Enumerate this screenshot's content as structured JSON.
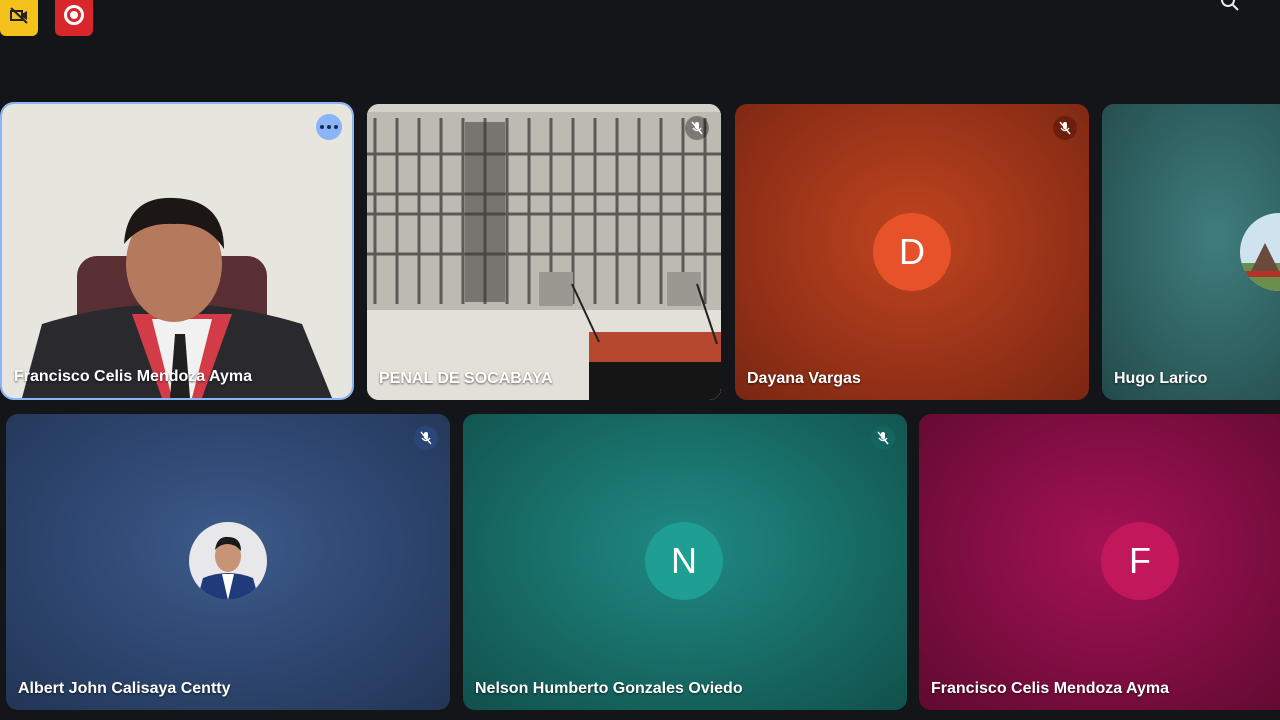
{
  "toolbar": {
    "left_icons": [
      "camera-off-icon",
      "record-icon"
    ],
    "right_icon": "search-icon"
  },
  "tiles": [
    {
      "name": "Francisco Celis Mendoza Ayma",
      "kind": "video",
      "active_speaker": true,
      "has_more_options": true
    },
    {
      "name": "PENAL DE SOCABAYA",
      "kind": "video",
      "muted": true
    },
    {
      "name": "Dayana Vargas",
      "kind": "letter-avatar",
      "initial": "D",
      "avatar_color": "#e8522a",
      "muted": true
    },
    {
      "name": "Hugo Larico",
      "kind": "photo-avatar"
    },
    {
      "name": "Albert John Calisaya Centty",
      "kind": "photo-avatar",
      "muted": true
    },
    {
      "name": "Nelson Humberto Gonzales Oviedo",
      "kind": "letter-avatar",
      "initial": "N",
      "avatar_color": "#1f9e93",
      "muted": true
    },
    {
      "name": "Francisco Celis Mendoza Ayma",
      "kind": "letter-avatar",
      "initial": "F",
      "avatar_color": "#c2185b"
    }
  ],
  "colors": {
    "background": "#141518",
    "active_outline": "#8ab4f8",
    "record": "#d9262b",
    "camera_off": "#f4c21a"
  }
}
